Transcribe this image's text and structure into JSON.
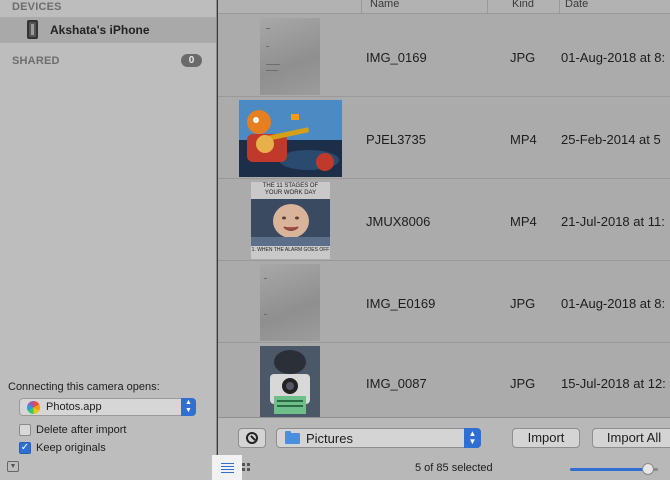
{
  "sidebar": {
    "devices_label": "DEVICES",
    "device_name": "Akshata's iPhone",
    "shared_label": "SHARED",
    "shared_count": "0",
    "connect_label": "Connecting this camera opens:",
    "app_selected": "Photos.app",
    "delete_after_import": {
      "label": "Delete after import",
      "checked": false
    },
    "keep_originals": {
      "label": "Keep originals",
      "checked": true
    }
  },
  "columns": {
    "name": "Name",
    "kind": "Kind",
    "date": "Date"
  },
  "rows": [
    {
      "name": "IMG_0169",
      "kind": "JPG",
      "date": "01-Aug-2018 at 8:"
    },
    {
      "name": "PJEL3735",
      "kind": "MP4",
      "date": "25-Feb-2014 at 5"
    },
    {
      "name": "JMUX8006",
      "kind": "MP4",
      "date": "21-Jul-2018 at 11:"
    },
    {
      "name": "IMG_E0169",
      "kind": "JPG",
      "date": "01-Aug-2018 at 8:"
    },
    {
      "name": "IMG_0087",
      "kind": "JPG",
      "date": "15-Jul-2018 at 12:"
    }
  ],
  "meme_text": {
    "line1": "THE 11 STAGES OF",
    "line2": "YOUR WORK DAY",
    "caption": "1. WHEN THE ALARM GOES OFF"
  },
  "toolbar": {
    "folder_selected": "Pictures",
    "import_label": "Import",
    "import_all_label": "Import All",
    "status": "5 of 85 selected",
    "thumbnail_size": 0.95
  },
  "colors": {
    "accent": "#2f6fd4",
    "sidebar_bg": "#bdbdbd",
    "content_bg": "#ababab"
  }
}
